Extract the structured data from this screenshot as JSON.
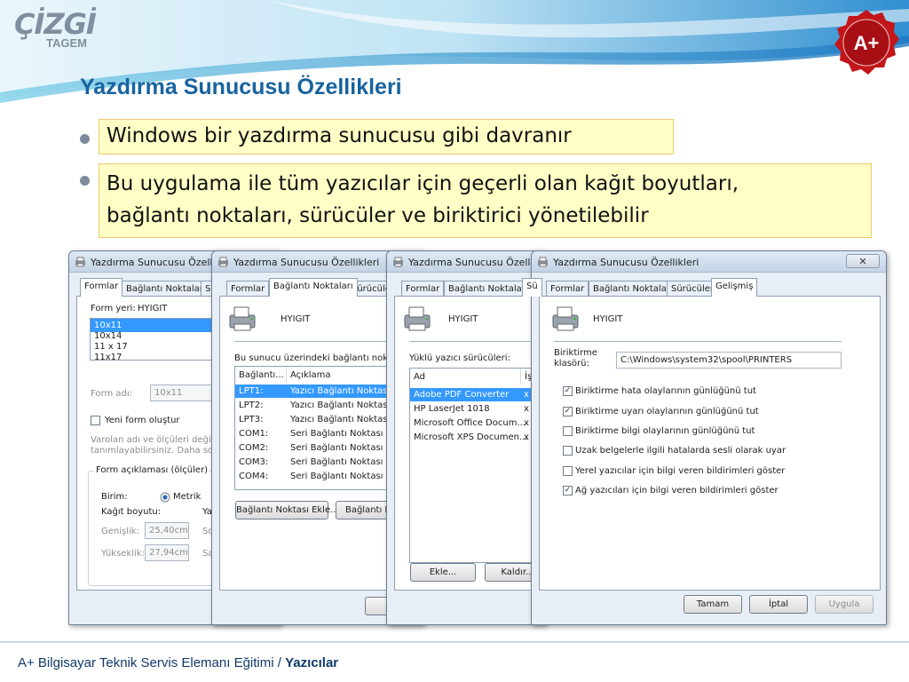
{
  "slide": {
    "logo_text": "ÇİZGİ",
    "logo_sub": "TAGEM",
    "seal_text": "A+",
    "title": "Yazdırma Sunucusu Özellikleri",
    "bullets": [
      "Windows bir yazdırma sunucusu gibi davranır",
      "Bu uygulama ile tüm yazıcılar için geçerli olan kağıt boyutları,",
      "bağlantı noktaları, sürücüler ve biriktirici yönetilebilir"
    ],
    "footer_course": "A+ Bilgisayar Teknik Servis Elemanı Eğitimi / ",
    "footer_topic": "Yazıcılar"
  },
  "colors": {
    "title": "#17639f",
    "highlight_bg": "#ffffc6",
    "highlight_border": "#f0c96d",
    "selection": "#3399ff",
    "footer": "#0e3a6b"
  },
  "icons": [
    "printer-icon",
    "close-icon",
    "checkbox-checked-icon",
    "radio-selected-icon",
    "quality-seal-icon"
  ],
  "dialog_title": "Yazdırma Sunucusu Özellikleri",
  "tabs": [
    "Formlar",
    "Bağlantı Noktaları",
    "Sürücüler",
    "Gelişmiş"
  ],
  "tab_cut": "Sü",
  "server_name": "HYIGIT",
  "win1": {
    "form_label": "Form yeri:",
    "form_value": "HYIGIT",
    "forms": [
      "10x11",
      "10x14",
      "11 x 17",
      "11x17"
    ],
    "form_name_label": "Form adı:",
    "form_name_value": "10x11",
    "new_form_label": "Yeni form oluştur",
    "desc1": "Varolan adı ve ölçüleri değiştire",
    "desc2": "tanımlayabilirsiniz.  Daha sonra",
    "group_label": "Form açıklaması (ölçüler)",
    "unit_label": "Birim:",
    "metric_label": "Metrik",
    "paper_size_label": "Kağıt boyutu:",
    "paper_cut": "Ya",
    "width_label": "Genişlik:",
    "width_value": "25,40cm",
    "width_cut": "So",
    "height_label": "Yükseklik:",
    "height_value": "27,94cm",
    "height_cut": "Sa"
  },
  "win2": {
    "ports_desc": "Bu sunucu üzerindeki bağlantı noktaları",
    "col_port": "Bağlantı...",
    "col_desc": "Açıklama",
    "ports": [
      {
        "port": "LPT1:",
        "desc": "Yazıcı Bağlantı Noktası"
      },
      {
        "port": "LPT2:",
        "desc": "Yazıcı Bağlantı Noktası"
      },
      {
        "port": "LPT3:",
        "desc": "Yazıcı Bağlantı Noktası"
      },
      {
        "port": "COM1:",
        "desc": "Seri Bağlantı Noktası"
      },
      {
        "port": "COM2:",
        "desc": "Seri Bağlantı Noktası"
      },
      {
        "port": "COM3:",
        "desc": "Seri Bağlantı Noktası"
      },
      {
        "port": "COM4:",
        "desc": "Seri Bağlantı Noktası"
      }
    ],
    "add_port_btn": "Bağlantı Noktası Ekle...",
    "port_btn_cut": "Bağlantı No",
    "ok_cut": "Ta"
  },
  "win3": {
    "drivers_label": "Yüklü yazıcı sürücüleri:",
    "col_name": "Ad",
    "col_cut": "İş",
    "drivers": [
      "Adobe PDF Converter",
      "HP LaserJet 1018",
      "Microsoft Office Docum...",
      "Microsoft XPS Documen..."
    ],
    "driver_cell_cut": "x",
    "add_btn": "Ekle...",
    "remove_btn": "Kaldır..."
  },
  "win4": {
    "spool_label_1": "Biriktirme",
    "spool_label_2": "klasörü:",
    "spool_path": "C:\\Windows\\system32\\spool\\PRINTERS",
    "options": [
      {
        "label": "Biriktirme hata olaylarının günlüğünü tut",
        "checked": true
      },
      {
        "label": "Biriktirme uyarı olaylarının günlüğünü tut",
        "checked": true
      },
      {
        "label": "Biriktirme bilgi olaylarının günlüğünü tut",
        "checked": false
      },
      {
        "label": "Uzak belgelerle ilgili  hatalarda sesli olarak uyar",
        "checked": false
      },
      {
        "label": "Yerel yazıcılar için bilgi veren bildirimleri göster",
        "checked": false
      },
      {
        "label": "Ağ yazıcıları için bilgi veren bildirimleri göster",
        "checked": true
      }
    ],
    "ok_btn": "Tamam",
    "cancel_btn": "İptal",
    "apply_btn": "Uygula"
  }
}
